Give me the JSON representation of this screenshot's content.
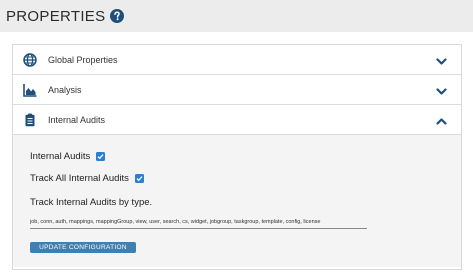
{
  "header": {
    "title": "PROPERTIES",
    "help_icon": "question-circle-icon"
  },
  "accordion": {
    "items": [
      {
        "label": "Global Properties",
        "icon": "globe-icon",
        "state": "collapsed"
      },
      {
        "label": "Analysis",
        "icon": "area-chart-icon",
        "state": "collapsed"
      },
      {
        "label": "Internal Audits",
        "icon": "clipboard-icon",
        "state": "expanded"
      }
    ]
  },
  "internal_audits": {
    "internal_audits_label": "Internal Audits",
    "internal_audits_checked": true,
    "track_all_label": "Track All Internal Audits",
    "track_all_checked": true,
    "track_by_type_label": "Track Internal Audits by type.",
    "types_value": "job, conn, auth, mappings, mappingGroup, view, user, search, cs, widget, jobgroup, taskgroup, template, config, license",
    "update_button_label": "UPDATE CONFIGURATION"
  },
  "colors": {
    "header_bg": "#ececec",
    "accent": "#2a7fd4",
    "button_bg": "#3f80b3",
    "icon_color": "#1f4f7a"
  }
}
